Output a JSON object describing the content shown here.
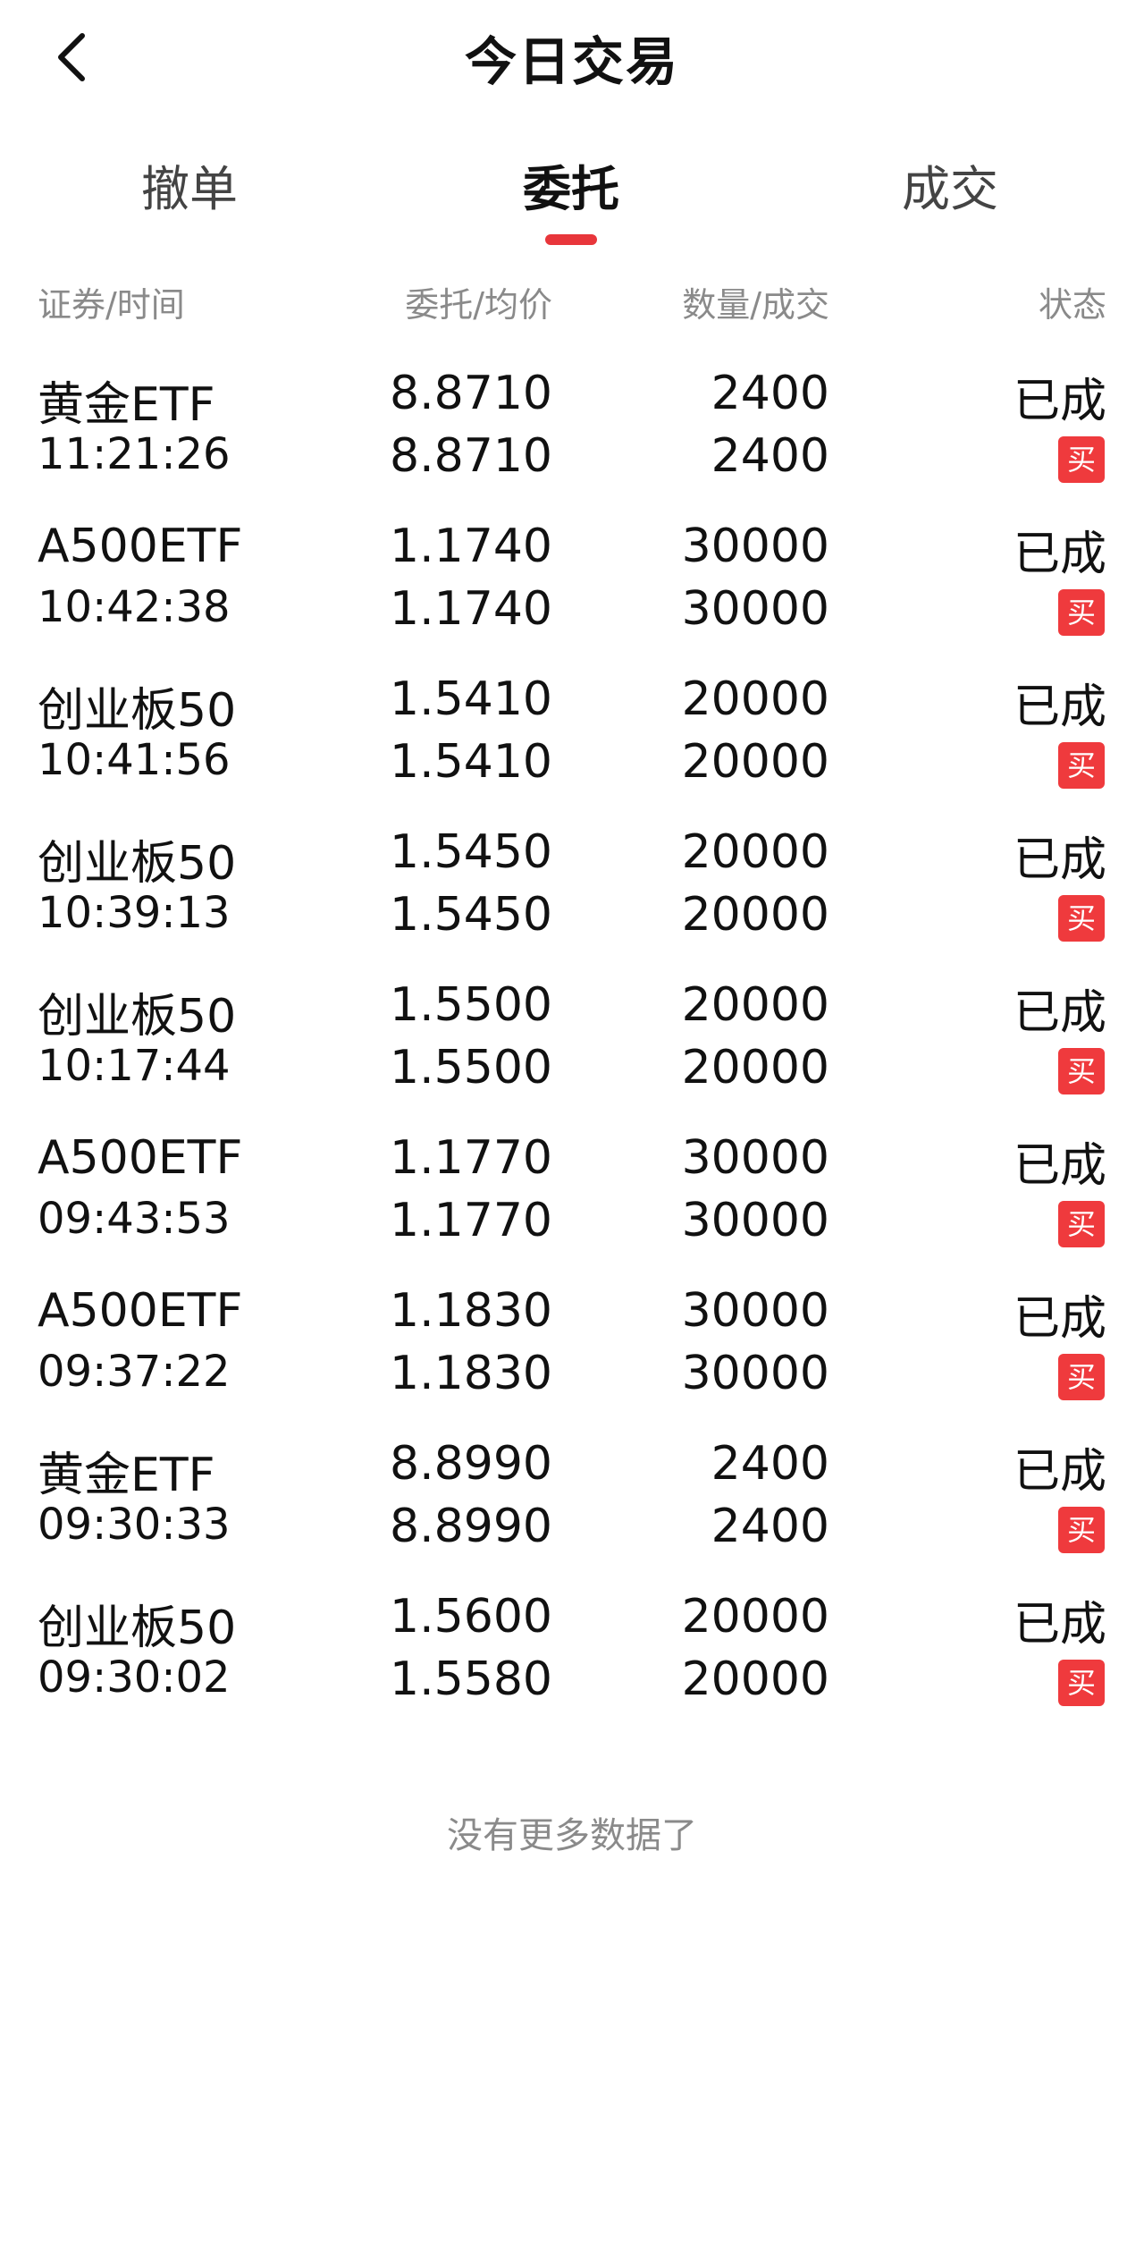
{
  "header": {
    "title": "今日交易",
    "back_icon": "chevron-left-icon"
  },
  "tabs": [
    {
      "label": "撤单",
      "active": false
    },
    {
      "label": "委托",
      "active": true
    },
    {
      "label": "成交",
      "active": false
    }
  ],
  "columns": {
    "security_time": "证券/时间",
    "price": "委托/均价",
    "quantity": "数量/成交",
    "status": "状态"
  },
  "rows": [
    {
      "name": "黄金ETF",
      "time": "11:21:26",
      "price": "8.8710",
      "avg_price": "8.8710",
      "quantity": "2400",
      "filled": "2400",
      "status": "已成",
      "side": "买"
    },
    {
      "name": "A500ETF",
      "time": "10:42:38",
      "price": "1.1740",
      "avg_price": "1.1740",
      "quantity": "30000",
      "filled": "30000",
      "status": "已成",
      "side": "买"
    },
    {
      "name": "创业板50",
      "time": "10:41:56",
      "price": "1.5410",
      "avg_price": "1.5410",
      "quantity": "20000",
      "filled": "20000",
      "status": "已成",
      "side": "买"
    },
    {
      "name": "创业板50",
      "time": "10:39:13",
      "price": "1.5450",
      "avg_price": "1.5450",
      "quantity": "20000",
      "filled": "20000",
      "status": "已成",
      "side": "买"
    },
    {
      "name": "创业板50",
      "time": "10:17:44",
      "price": "1.5500",
      "avg_price": "1.5500",
      "quantity": "20000",
      "filled": "20000",
      "status": "已成",
      "side": "买"
    },
    {
      "name": "A500ETF",
      "time": "09:43:53",
      "price": "1.1770",
      "avg_price": "1.1770",
      "quantity": "30000",
      "filled": "30000",
      "status": "已成",
      "side": "买"
    },
    {
      "name": "A500ETF",
      "time": "09:37:22",
      "price": "1.1830",
      "avg_price": "1.1830",
      "quantity": "30000",
      "filled": "30000",
      "status": "已成",
      "side": "买"
    },
    {
      "name": "黄金ETF",
      "time": "09:30:33",
      "price": "8.8990",
      "avg_price": "8.8990",
      "quantity": "2400",
      "filled": "2400",
      "status": "已成",
      "side": "买"
    },
    {
      "name": "创业板50",
      "time": "09:30:02",
      "price": "1.5600",
      "avg_price": "1.5580",
      "quantity": "20000",
      "filled": "20000",
      "status": "已成",
      "side": "买"
    }
  ],
  "footer": {
    "no_more": "没有更多数据了"
  },
  "colors": {
    "accent": "#e8363b",
    "buy_badge": "#ef3a3d",
    "muted_text": "#8a8a8a"
  }
}
